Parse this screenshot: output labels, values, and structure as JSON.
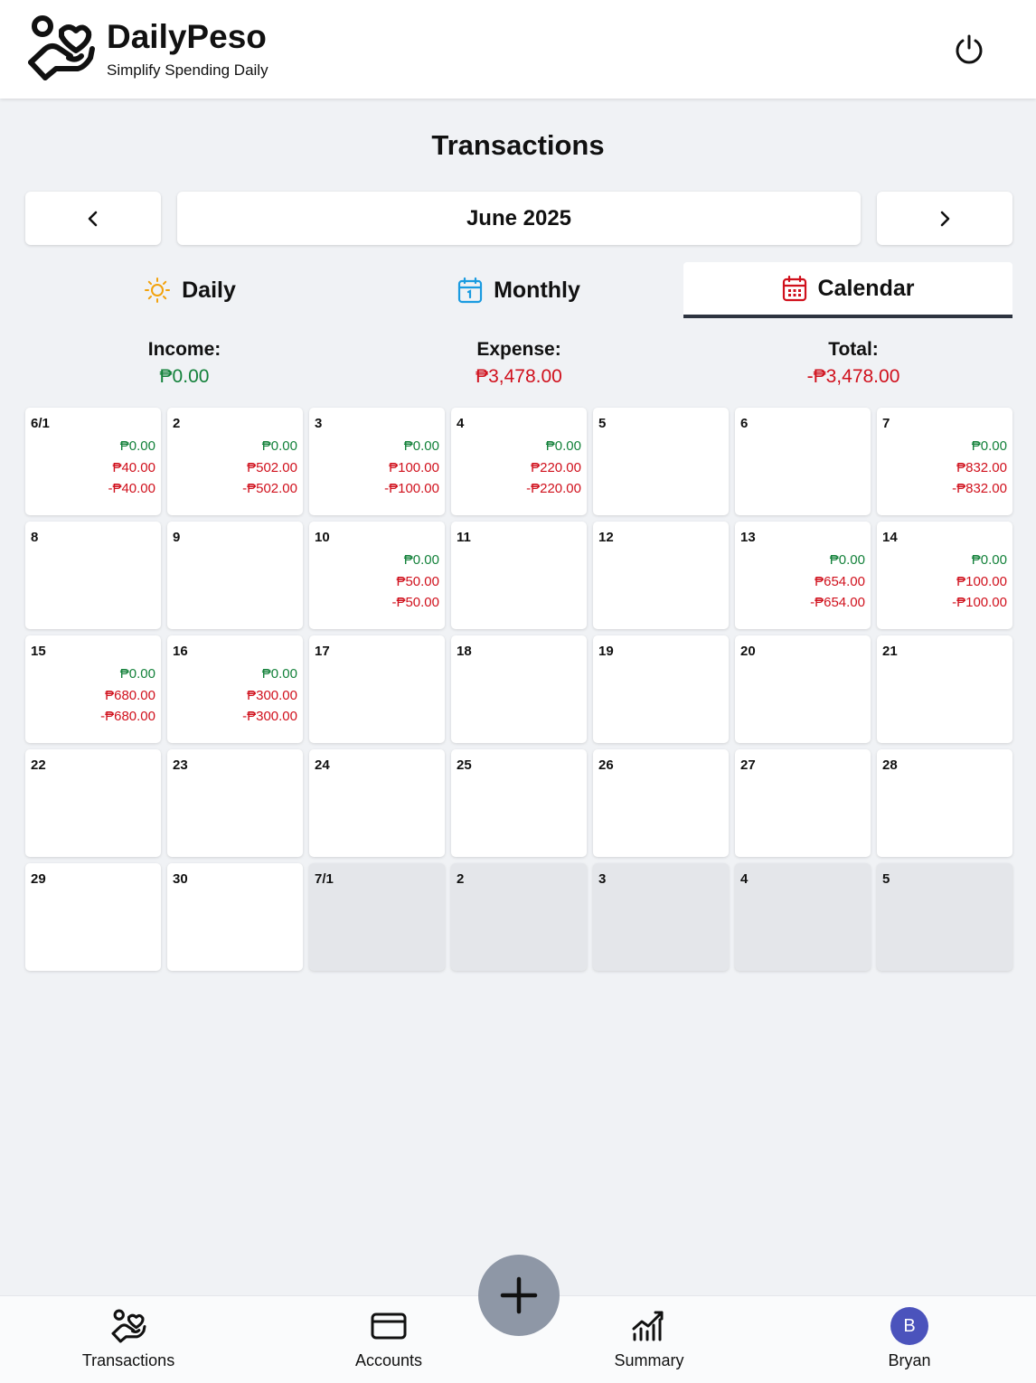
{
  "header": {
    "app_name": "DailyPeso",
    "tagline": "Simplify Spending Daily",
    "logo_icon": "hand-heart-icon",
    "power_icon": "power-icon"
  },
  "page_title": "Transactions",
  "month_nav": {
    "prev_icon": "chevron-left-icon",
    "label": "June 2025",
    "next_icon": "chevron-right-icon"
  },
  "tabs": [
    {
      "label": "Daily",
      "icon": "sun-icon",
      "icon_color": "#f2a20c",
      "active": false
    },
    {
      "label": "Monthly",
      "icon": "calendar-icon",
      "icon_color": "#1a9be0",
      "active": false
    },
    {
      "label": "Calendar",
      "icon": "calendar-grid-icon",
      "icon_color": "#d0101c",
      "active": true
    }
  ],
  "totals": {
    "income_label": "Income:",
    "income_value": "₱0.00",
    "expense_label": "Expense:",
    "expense_value": "₱3,478.00",
    "total_label": "Total:",
    "total_value": "-₱3,478.00"
  },
  "colors": {
    "income": "#13813a",
    "expense": "#d0101c",
    "fab": "#8e97a6",
    "avatar": "#4b53bc"
  },
  "calendar": {
    "days": [
      {
        "label": "6/1",
        "income": "₱0.00",
        "expense": "₱40.00",
        "total": "-₱40.00"
      },
      {
        "label": "2",
        "income": "₱0.00",
        "expense": "₱502.00",
        "total": "-₱502.00"
      },
      {
        "label": "3",
        "income": "₱0.00",
        "expense": "₱100.00",
        "total": "-₱100.00"
      },
      {
        "label": "4",
        "income": "₱0.00",
        "expense": "₱220.00",
        "total": "-₱220.00"
      },
      {
        "label": "5"
      },
      {
        "label": "6"
      },
      {
        "label": "7",
        "income": "₱0.00",
        "expense": "₱832.00",
        "total": "-₱832.00"
      },
      {
        "label": "8"
      },
      {
        "label": "9"
      },
      {
        "label": "10",
        "income": "₱0.00",
        "expense": "₱50.00",
        "total": "-₱50.00"
      },
      {
        "label": "11"
      },
      {
        "label": "12"
      },
      {
        "label": "13",
        "income": "₱0.00",
        "expense": "₱654.00",
        "total": "-₱654.00"
      },
      {
        "label": "14",
        "income": "₱0.00",
        "expense": "₱100.00",
        "total": "-₱100.00"
      },
      {
        "label": "15",
        "income": "₱0.00",
        "expense": "₱680.00",
        "total": "-₱680.00"
      },
      {
        "label": "16",
        "income": "₱0.00",
        "expense": "₱300.00",
        "total": "-₱300.00"
      },
      {
        "label": "17"
      },
      {
        "label": "18"
      },
      {
        "label": "19"
      },
      {
        "label": "20"
      },
      {
        "label": "21"
      },
      {
        "label": "22"
      },
      {
        "label": "23"
      },
      {
        "label": "24"
      },
      {
        "label": "25"
      },
      {
        "label": "26"
      },
      {
        "label": "27"
      },
      {
        "label": "28"
      },
      {
        "label": "29"
      },
      {
        "label": "30"
      },
      {
        "label": "7/1",
        "outside_month": true
      },
      {
        "label": "2",
        "outside_month": true
      },
      {
        "label": "3",
        "outside_month": true
      },
      {
        "label": "4",
        "outside_month": true
      },
      {
        "label": "5",
        "outside_month": true
      }
    ]
  },
  "fab": {
    "icon": "plus-icon"
  },
  "bottom_nav": [
    {
      "label": "Transactions",
      "icon": "hand-heart-icon"
    },
    {
      "label": "Accounts",
      "icon": "credit-card-icon"
    },
    {
      "label": "Summary",
      "icon": "chart-trend-icon"
    },
    {
      "label": "Bryan",
      "icon": "avatar",
      "avatar_initial": "B"
    }
  ]
}
